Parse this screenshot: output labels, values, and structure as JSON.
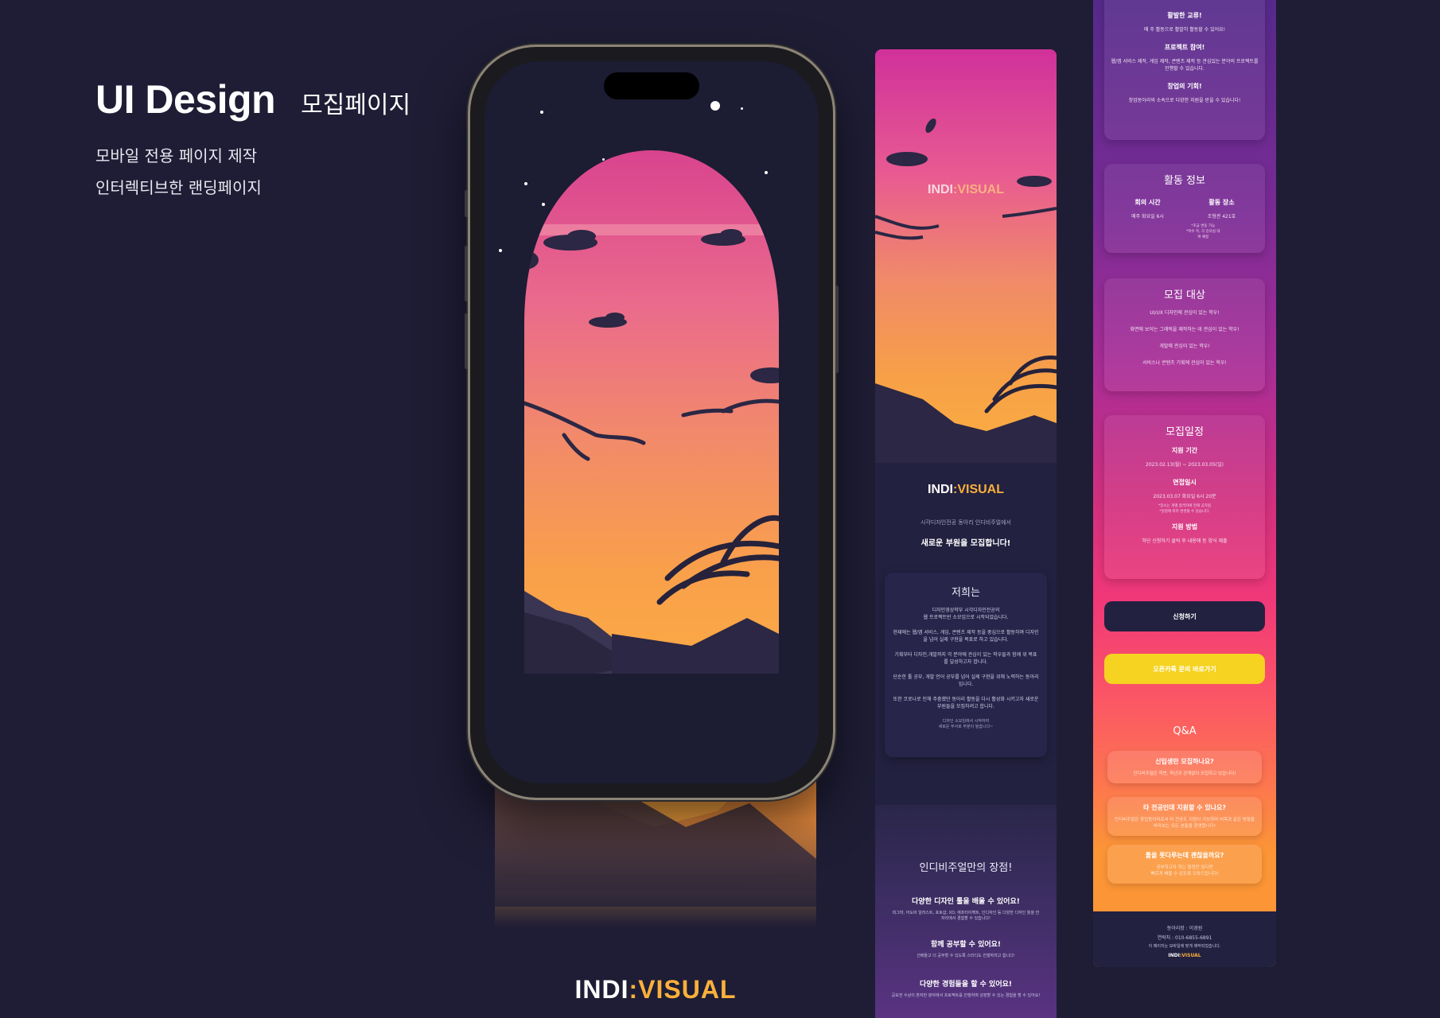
{
  "header": {
    "title": "UI Design",
    "subtitle": "모집페이지",
    "lines": [
      "모바일 전용 페이지 제작",
      "인터렉티브한 랜딩페이지"
    ]
  },
  "brand": {
    "indi": "INDI",
    "sep": ":",
    "visual": "VISUAL",
    "accent": "#fbb03b"
  },
  "landing": {
    "intro_small": "시각디자인전공 동아리 인디비주얼에서",
    "headline": "새로운 부원을 모집합니다!",
    "about": {
      "title": "저희는",
      "paragraphs": [
        "디자인영상학부 시각디자인전공의\n웹 프로젝트반 소모임으로 시작되었습니다.",
        "현재에는 웹/앱 서비스, 게임, 콘텐츠 제작 등을 중심으로 활동하며 디자인을 넘어 실제 구현을 목표로 하고 있습니다.",
        "기획부터 디자인,개발까지 각 분야에 관심이 있는 학우들과 함께 위 목표를 달성하고자 합니다.",
        "단순한 툴 공부, 개발 언어 공부를 넘어 실제 구현을 위해 노력하는 동아리입니다.",
        "또한 코로나로 인해 주춤했던 동아리 활동을 다시 활성화 시키고자 새로운 부원들을 모집하려고 합니다."
      ],
      "note": "디자인 소모임에서 시작하여\n새로운 부서로 부분이 될습니다~"
    },
    "features_title": "인디비주얼만의 장점!",
    "features": [
      {
        "title": "다양한 디자인 툴을 배울 수 있어요!",
        "text": "피그마, 어도비 일러스트, 포토샵, XD, 애프터이펙트, 인디자인 등 다양한 디자인 툴을 한 자리에서 경험할 수 있습니다!"
      },
      {
        "title": "함께 공부할 수 있어요!",
        "text": "선배들고 더 공부할 수 있도록 스터디도 진행하려고 합니다!"
      },
      {
        "title": "다양한 경험들을 할 수 있어요!",
        "text": "공모전 수상이 혼자만 분야에서 프로젝트를 진행하며 성장할 수 있는 경험을 할 수 있어요!"
      },
      {
        "title": "활발한 교류!",
        "text": "매 주 활동으로 활발히 활동할 수 있어요!"
      }
    ]
  },
  "right": {
    "top_features": [
      {
        "title": "활발한 교류!",
        "text": "매 주 활동으로 활발히 활동할 수 있어요!"
      },
      {
        "title": "프로젝트 참여!",
        "text": "웹/앱 서비스 제작, 게임 제작, 콘텐츠 제작 등 관심있는 분야의 프로젝트를 진행할 수 있습니다."
      },
      {
        "title": "창업의 기회!",
        "text": "창업동아리와 소속으로 다양한 지원을 받을 수 있습니다!"
      }
    ],
    "activity": {
      "title": "활동 정보",
      "col1_title": "회의 시간",
      "col1_text": "매주 화요일 6시",
      "col2_title": "활동 장소",
      "col2_text": "조형관 421호",
      "col2_small": "*조금 변동 가능\n*학수 목, 각 강의실 대여 예정"
    },
    "target": {
      "title": "모집 대상",
      "items": [
        "UI/UX 디자인에 관심이 있는 학우!",
        "화면에 보이는 그래픽을 제작하는 데 관심이 있는 학우!",
        "개발에 관심이 있는 학우!",
        "서비스나 콘텐츠 기획에 관심이 있는 학우!"
      ]
    },
    "schedule": {
      "title": "모집일정",
      "period_label": "지원 기간",
      "period": "2023.02.13(월) ~ 2023.03.05(일)",
      "interview_label": "면접일시",
      "interview": "2023.03.07 화요일 6시 20분",
      "interview_note": "*장소는 개별 합격자에 한해 공지됨\n*일정에 따라 변경될 수 있습니다.",
      "method_label": "지원 방법",
      "method": "하단 신청하기 클릭 후 내용에 등 양식 제출"
    },
    "apply_button": "신청하기",
    "kakao_button": "오픈카톡 문의 바로가기",
    "qa_title": "Q&A",
    "qa": [
      {
        "q": "신입생만 모집하나요?",
        "a": "인디비주얼은 학번, 학년과 관계없이 모집하고 있습니다!"
      },
      {
        "q": "타 전공인데 지원할 수 있나요?",
        "a": "인디비주얼은 창업동아리로서 타 전공도 지원이 가능하며 비목과 같은 방향을 바라보는 모든 분들을 환영합니다!"
      },
      {
        "q": "툴을 못다루는데 괜찮을까요?",
        "a": "공부하고자 하는 열정만 있다면\n빠르게 배울 수 있도록 도와드립니다!"
      }
    ],
    "footer": {
      "leader": "동아리장 : 이경원",
      "contact": "연락처 : 010-6855-6891",
      "copyright": "이 페이지는 모바일에 맞게 제작되었습니다."
    }
  }
}
